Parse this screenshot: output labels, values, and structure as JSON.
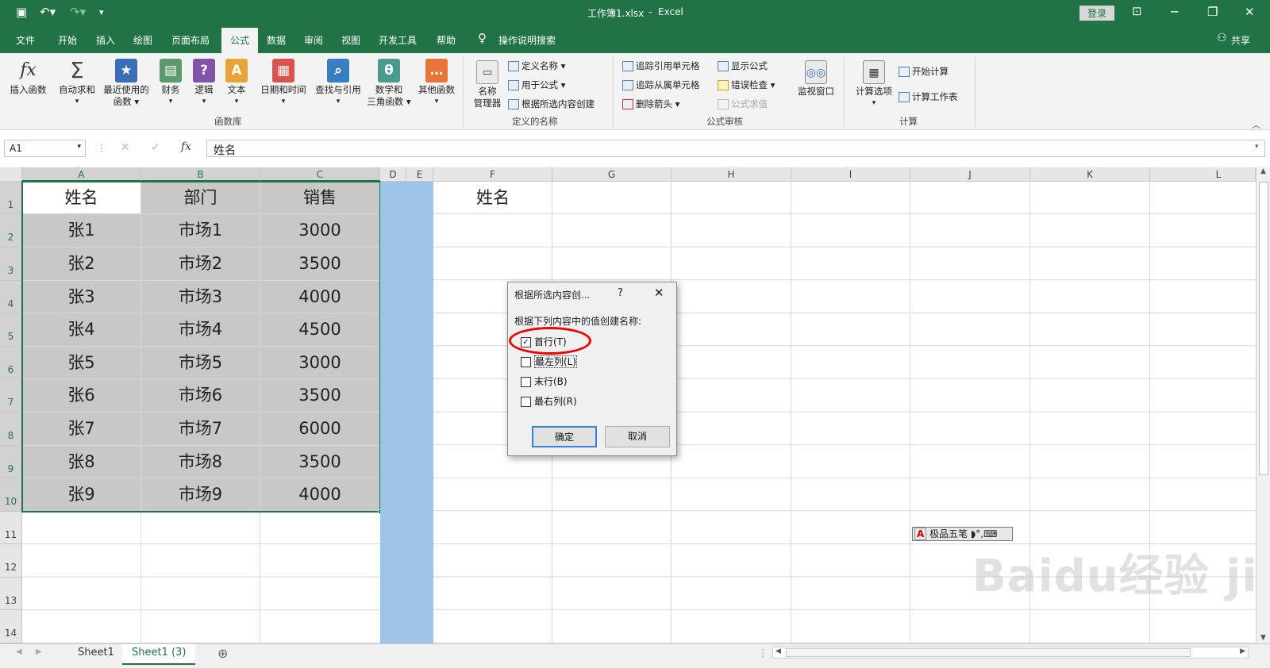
{
  "title": {
    "file": "工作簿1.xlsx",
    "sep": "-",
    "app": "Excel",
    "login": "登录"
  },
  "menus": [
    "文件",
    "开始",
    "插入",
    "绘图",
    "页面布局",
    "公式",
    "数据",
    "审阅",
    "视图",
    "开发工具",
    "帮助"
  ],
  "search_label": "操作说明搜索",
  "share": "共享",
  "ribbon": {
    "insert_fn": "插入函数",
    "autosum": "自动求和",
    "recent_1": "最近使用的",
    "recent_2": "函数",
    "finance": "财务",
    "logic": "逻辑",
    "text": "文本",
    "datetime": "日期和时间",
    "lookup": "查找与引用",
    "math_1": "数学和",
    "math_2": "三角函数",
    "other": "其他函数",
    "namemgr_1": "名称",
    "namemgr_2": "管理器",
    "define": "定义名称",
    "use": "用于公式",
    "create": "根据所选内容创建",
    "trace_pre": "追踪引用单元格",
    "trace_dep": "追踪从属单元格",
    "remove": "删除箭头",
    "show": "显示公式",
    "check": "错误检查",
    "eval": "公式求值",
    "watch": "监视窗口",
    "calc_opt": "计算选项",
    "calc_now": "开始计算",
    "calc_sheet": "计算工作表",
    "g1": "函数库",
    "g2": "定义的名称",
    "g3": "公式审核",
    "g4": "计算"
  },
  "namebox": "A1",
  "formula": "姓名",
  "columns": [
    "A",
    "B",
    "C",
    "D",
    "E",
    "F",
    "G",
    "H",
    "I",
    "J",
    "K",
    "L"
  ],
  "rows": [
    "1",
    "2",
    "3",
    "4",
    "5",
    "6",
    "7",
    "8",
    "9",
    "10",
    "11",
    "12",
    "13",
    "14"
  ],
  "cells": [
    [
      "姓名",
      "部门",
      "销售"
    ],
    [
      "张1",
      "市场1",
      "3000"
    ],
    [
      "张2",
      "市场2",
      "3500"
    ],
    [
      "张3",
      "市场3",
      "4000"
    ],
    [
      "张4",
      "市场4",
      "4500"
    ],
    [
      "张5",
      "市场5",
      "3000"
    ],
    [
      "张6",
      "市场6",
      "3500"
    ],
    [
      "张7",
      "市场7",
      "6000"
    ],
    [
      "张8",
      "市场8",
      "3500"
    ],
    [
      "张9",
      "市场9",
      "4000"
    ]
  ],
  "f1": "姓名",
  "ime": "极品五笔",
  "dialog": {
    "title": "根据所选内容创...",
    "help": "?",
    "prompt": "根据下列内容中的值创建名称:",
    "opt1": "首行(T)",
    "opt2": "最左列(L)",
    "opt3": "末行(B)",
    "opt4": "最右列(R)",
    "ok": "确定",
    "cancel": "取消"
  },
  "tabs": [
    "Sheet1",
    "Sheet1 (3)"
  ],
  "watermark": "Baidu经验 jingyan.baidu.com"
}
